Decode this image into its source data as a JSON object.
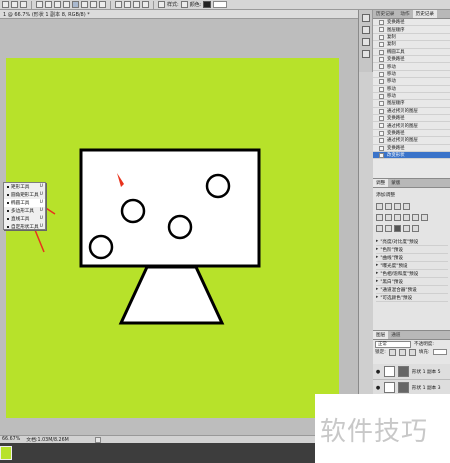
{
  "options_bar": {
    "style_label": "样式:",
    "color_label": "颜色:"
  },
  "document_tab": {
    "title": "1 @ 66.7% (形状 1 副本 8, RGB/8) *"
  },
  "tool_flyout": {
    "items": [
      {
        "label": "矩形工具",
        "key": "U",
        "selected": false
      },
      {
        "label": "圆角矩形工具",
        "key": "U",
        "selected": false
      },
      {
        "label": "椭圆工具",
        "key": "U",
        "selected": true
      },
      {
        "label": "多边形工具",
        "key": "U",
        "selected": false
      },
      {
        "label": "直线工具",
        "key": "U",
        "selected": false
      },
      {
        "label": "自定形状工具",
        "key": "U",
        "selected": false
      }
    ]
  },
  "status_bar": {
    "zoom": "66.67%",
    "doc_info": "文档:1.03M/8.26M"
  },
  "history_panel": {
    "tabs": [
      "历史记录",
      "动作",
      "历史记录"
    ],
    "items": [
      "变换路径",
      "图层顺序",
      "复制",
      "复制",
      "椭圆工具",
      "变换路径",
      "移动",
      "移动",
      "移动",
      "移动",
      "移动",
      "图层顺序",
      "通过拷贝的图层",
      "变换路径",
      "通过拷贝的图层",
      "变换路径",
      "通过拷贝的图层",
      "变换路径",
      "改变形状"
    ],
    "current_index": 18
  },
  "adjustments_panel": {
    "tabs": [
      "调整",
      "蒙版"
    ],
    "title": "添加调整",
    "presets": [
      "\"亮度/对比度\"预设",
      "\"色阶\"预设",
      "\"曲线\"预设",
      "\"曝光度\"预设",
      "\"色相/饱和度\"预设",
      "\"黑白\"预设",
      "\"通道混合器\"预设",
      "\"可选颜色\"预设"
    ]
  },
  "layers_panel": {
    "tabs": [
      "图层",
      "通道"
    ],
    "blend_mode": "正常",
    "opacity_label": "不透明度:",
    "lock_label": "锁定:",
    "fill_label": "填充:",
    "layers": [
      {
        "name": "形状 1 副本 5"
      },
      {
        "name": "形状 1 副本 3"
      }
    ]
  },
  "watermark": {
    "text": "软件技巧"
  },
  "colors": {
    "artboard": "#b7e22a",
    "annotation_arrow": "#e8321c"
  }
}
